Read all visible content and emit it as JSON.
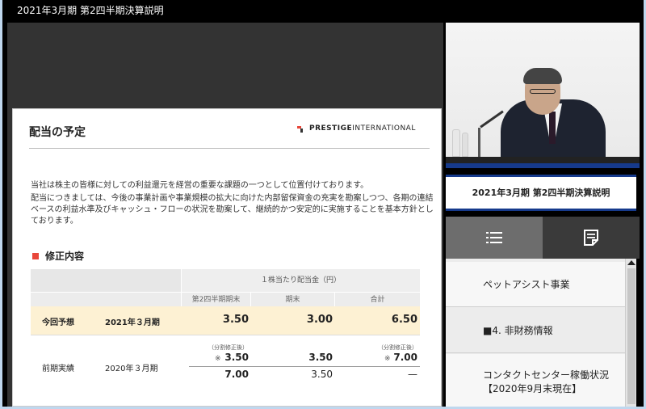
{
  "window": {
    "title": "2021年3月期 第2四半期決算説明"
  },
  "slide": {
    "title": "配当の予定",
    "logo": {
      "part1": "PRESTIGE",
      "part2": "INTERNATIONAL"
    },
    "paragraph1": "当社は株主の皆様に対しての利益還元を経営の重要な課題の一つとして位置付けております。",
    "paragraph2": "配当につきましては、今後の事業計画や事業規模の拡大に向けた内部留保資金の充実を勘案しつつ、各期の連結ベースの利益水準及びキャッシュ・フローの状況を勘案して、継続的かつ安定的に実施することを基本方針としております。",
    "section_title": "修正内容",
    "table": {
      "header_span": "１株当たり配当金（円）",
      "col_q2": "第2四半期期末",
      "col_end": "期末",
      "col_total": "合計",
      "forecast": {
        "label": "今回予想",
        "period": "2021年３月期",
        "q2": "3.50",
        "end": "3.00",
        "total": "6.50"
      },
      "prior": {
        "label": "前期実績",
        "period": "2020年３月期",
        "note_split": "（分割修正後）",
        "mark": "※",
        "q2_adj": "3.50",
        "end_adj": "3.50",
        "total_adj": "7.00",
        "q2": "7.00",
        "end": "3.50",
        "total": "—"
      }
    }
  },
  "sidebar": {
    "video_title": "2021年3月期 第2四半期決算説明",
    "tabs": [
      {
        "icon": "list-icon",
        "active": true
      },
      {
        "icon": "document-icon",
        "active": false
      }
    ],
    "items": [
      {
        "label": "ペットアシスト事業"
      },
      {
        "label": "■4. 非財務情報"
      },
      {
        "line1": "コンタクトセンター稼働状況",
        "line2": "【2020年9月末現在】"
      }
    ]
  },
  "colors": {
    "accent_red": "#e8473a",
    "brand_blue": "#163a8c",
    "forecast_row": "#fdf1d3"
  }
}
